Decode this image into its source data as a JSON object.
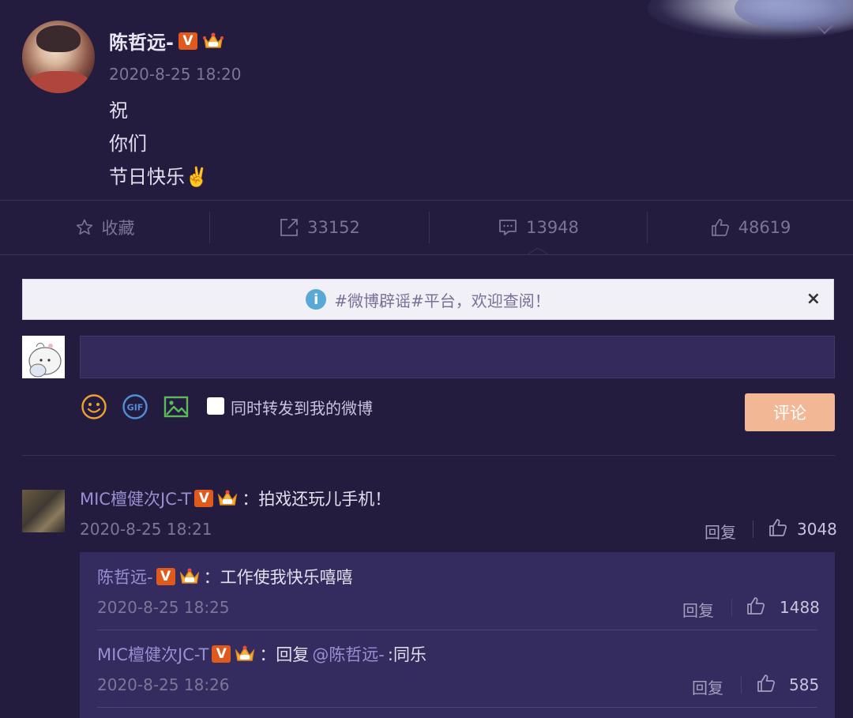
{
  "post": {
    "username": "陈哲远-",
    "time": "2020-8-25 18:20",
    "lines": [
      "祝",
      "你们",
      "节日快乐✌️"
    ]
  },
  "actions": {
    "favorite_label": "收藏",
    "repost_count": "33152",
    "comment_count": "13948",
    "like_count": "48619"
  },
  "notice": {
    "text": "#微博辟谣#平台，欢迎查阅！",
    "close": "×"
  },
  "composer": {
    "checkbox_label": "同时转发到我的微博",
    "submit_label": "评论"
  },
  "comments": [
    {
      "name": "MIC檀健次JC-T",
      "text": "：拍戏还玩儿手机！",
      "time": "2020-8-25 18:21",
      "reply": "回复",
      "likes": "3048"
    }
  ],
  "replies": [
    {
      "name": "陈哲远-",
      "text": "：工作使我快乐嘻嘻",
      "time": "2020-8-25 18:25",
      "reply": "回复",
      "likes": "1488"
    },
    {
      "name": "MIC檀健次JC-T",
      "text_prefix": "：回复",
      "mention": "@陈哲远-",
      "text_suffix": ":同乐",
      "time": "2020-8-25 18:26",
      "reply": "回复",
      "likes": "585"
    }
  ],
  "icons": {
    "badge_v": "V",
    "crown": "crown-icon",
    "star": "star-icon",
    "repost": "repost-icon",
    "comment": "comment-icon",
    "like": "thumbs-up-icon",
    "emoji": "emoji-icon",
    "gif": "gif-icon",
    "image": "image-icon",
    "info": "i"
  },
  "colors": {
    "background": "#241c3e",
    "accent_name": "#9a8fd3",
    "verified_badge": "#e05a1e",
    "submit_button": "#f2b896"
  }
}
